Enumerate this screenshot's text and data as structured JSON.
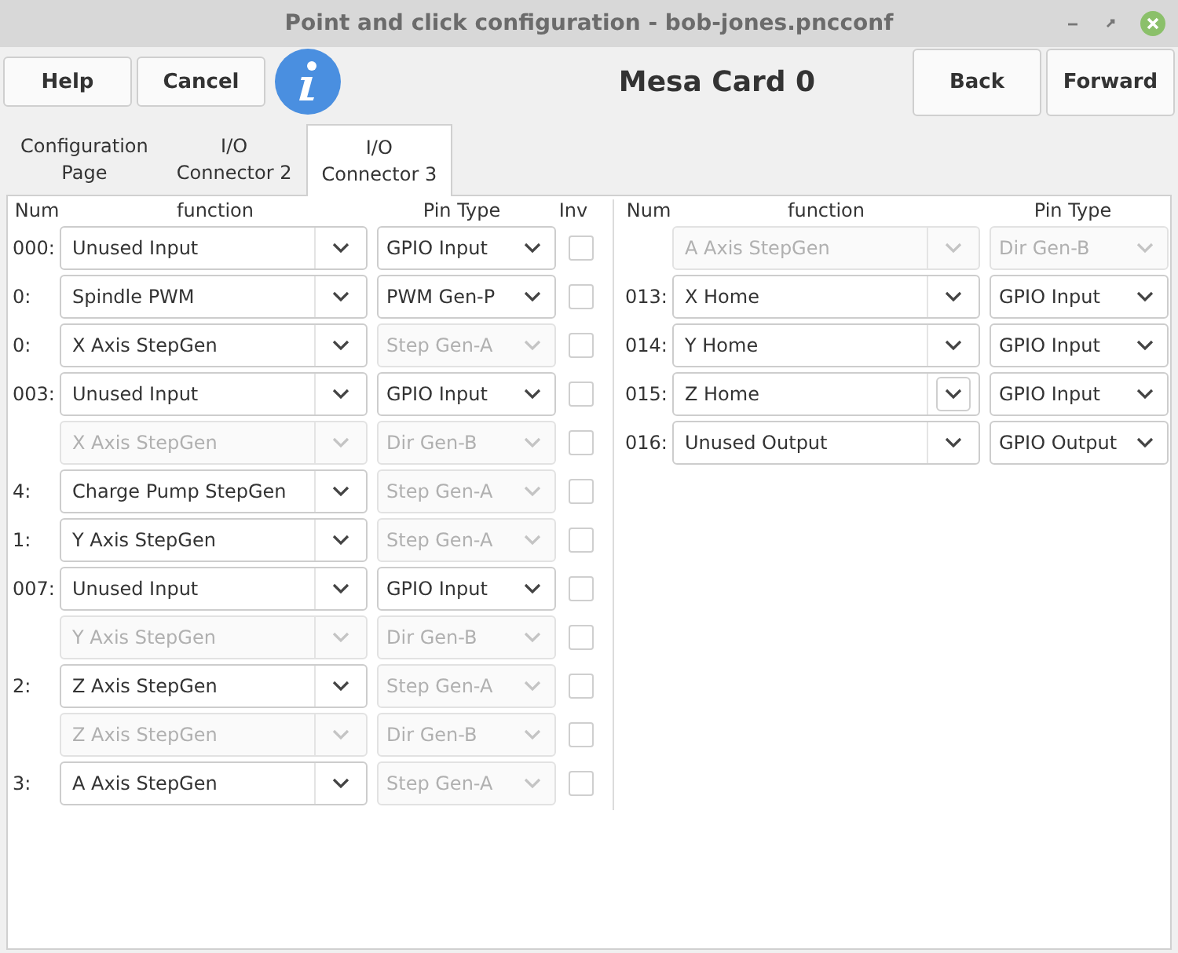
{
  "window": {
    "title": "Point and click configuration - bob-jones.pncconf"
  },
  "toolbar": {
    "buttons": [
      {
        "label": "Help"
      },
      {
        "label": "Cancel"
      }
    ],
    "heading": "Mesa Card 0",
    "nav_buttons": [
      {
        "label": "Back"
      },
      {
        "label": "Forward"
      }
    ]
  },
  "tabs": [
    {
      "label": "Configuration\nPage",
      "selected": false
    },
    {
      "label": "I/O\nConnector 2",
      "selected": false
    },
    {
      "label": "I/O\nConnector 3",
      "selected": true
    }
  ],
  "left_table": {
    "columns": [
      "Num",
      "function",
      "Pin Type",
      "Inv"
    ],
    "rows": [
      {
        "num": "000:",
        "function": "Unused Input",
        "function_disabled": false,
        "pin_type": "GPIO Input",
        "pin_disabled": false,
        "inverted": false
      },
      {
        "num": "0:",
        "function": "Spindle PWM",
        "function_disabled": false,
        "pin_type": "PWM Gen-P",
        "pin_disabled": false,
        "inverted": false
      },
      {
        "num": "0:",
        "function": "X Axis StepGen",
        "function_disabled": false,
        "pin_type": "Step Gen-A",
        "pin_disabled": true,
        "inverted": false
      },
      {
        "num": "003:",
        "function": "Unused Input",
        "function_disabled": false,
        "pin_type": "GPIO Input",
        "pin_disabled": false,
        "inverted": false
      },
      {
        "function": "X Axis StepGen",
        "function_disabled": true,
        "pin_type": "Dir Gen-B",
        "pin_disabled": true,
        "inverted": false
      },
      {
        "num": "4:",
        "function": "Charge Pump StepGen",
        "function_disabled": false,
        "pin_type": "Step Gen-A",
        "pin_disabled": true,
        "inverted": false
      },
      {
        "num": "1:",
        "function": "Y Axis StepGen",
        "function_disabled": false,
        "pin_type": "Step Gen-A",
        "pin_disabled": true,
        "inverted": false
      },
      {
        "num": "007:",
        "function": "Unused Input",
        "function_disabled": false,
        "pin_type": "GPIO Input",
        "pin_disabled": false,
        "inverted": false
      },
      {
        "function": "Y Axis StepGen",
        "function_disabled": true,
        "pin_type": "Dir Gen-B",
        "pin_disabled": true,
        "inverted": false
      },
      {
        "num": "2:",
        "function": "Z Axis StepGen",
        "function_disabled": false,
        "pin_type": "Step Gen-A",
        "pin_disabled": true,
        "inverted": false
      },
      {
        "function": "Z Axis StepGen",
        "function_disabled": true,
        "pin_type": "Dir Gen-B",
        "pin_disabled": true,
        "inverted": false
      },
      {
        "num": "3:",
        "function": "A Axis StepGen",
        "function_disabled": false,
        "pin_type": "Step Gen-A",
        "pin_disabled": true,
        "inverted": false
      }
    ]
  },
  "right_table": {
    "columns": [
      "Num",
      "function",
      "Pin Type"
    ],
    "rows": [
      {
        "function": "A Axis StepGen",
        "function_disabled": true,
        "pin_type": "Dir Gen-B",
        "pin_disabled": true,
        "hovered": false
      },
      {
        "num": "013:",
        "function": "X Home",
        "function_disabled": false,
        "pin_type": "GPIO Input",
        "pin_disabled": false,
        "hovered": false
      },
      {
        "num": "014:",
        "function": "Y Home",
        "function_disabled": false,
        "pin_type": "GPIO Input",
        "pin_disabled": false,
        "hovered": false
      },
      {
        "num": "015:",
        "function": "Z Home",
        "function_disabled": false,
        "pin_type": "GPIO Input",
        "pin_disabled": false,
        "hovered": true
      },
      {
        "num": "016:",
        "function": "Unused Output",
        "function_disabled": false,
        "pin_type": "GPIO Output",
        "pin_disabled": false,
        "hovered": false
      }
    ]
  }
}
